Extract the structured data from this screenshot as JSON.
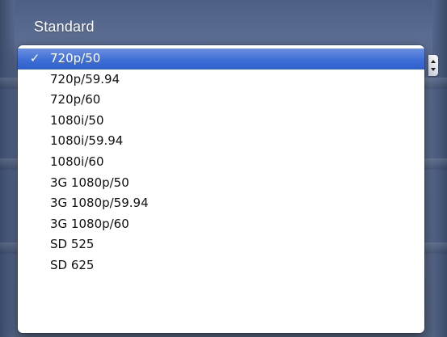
{
  "section": {
    "label": "Standard"
  },
  "menu": {
    "selected_index": 0,
    "check_glyph": "✓",
    "items": [
      {
        "label": "720p/50"
      },
      {
        "label": "720p/59.94"
      },
      {
        "label": "720p/60"
      },
      {
        "label": "1080i/50"
      },
      {
        "label": "1080i/59.94"
      },
      {
        "label": "1080i/60"
      },
      {
        "label": "3G 1080p/50"
      },
      {
        "label": "3G 1080p/59.94"
      },
      {
        "label": "3G 1080p/60"
      },
      {
        "label": "SD 525"
      },
      {
        "label": "SD 625"
      }
    ]
  },
  "colors": {
    "background_panel": "#56678a",
    "selection_highlight": "#3e6fd6",
    "menu_background": "#ffffff",
    "menu_text": "#111111",
    "selected_text": "#ffffff"
  },
  "icons": {
    "checkmark": "checkmark-icon",
    "popup_arrows": "popup-arrows-icon"
  }
}
